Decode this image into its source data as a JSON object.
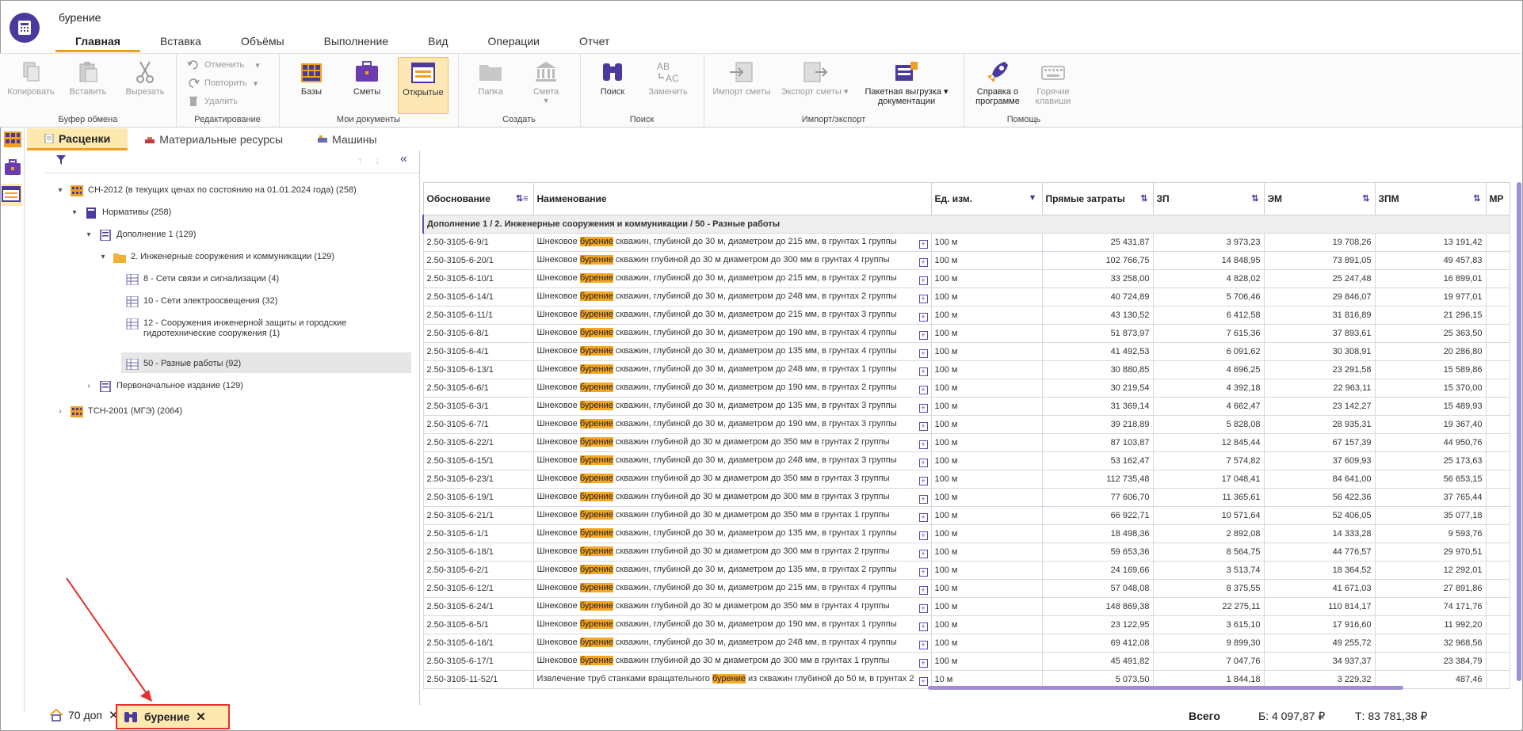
{
  "app": {
    "title": "бурение"
  },
  "ribbon_tabs": [
    "Главная",
    "Вставка",
    "Объёмы",
    "Выполнение",
    "Вид",
    "Операции",
    "Отчет"
  ],
  "ribbon": {
    "clipboard": {
      "group": "Буфер обмена",
      "copy": "Копировать",
      "paste": "Вставить",
      "cut": "Вырезать"
    },
    "editing": {
      "group": "Редактирование",
      "undo": "Отменить",
      "redo": "Повторить",
      "delete": "Удалить"
    },
    "mydocs": {
      "group": "Мои документы",
      "bases": "Базы",
      "estimates": "Сметы",
      "open": "Открытые"
    },
    "create": {
      "group": "Создать",
      "folder": "Папка",
      "estimate": "Смета"
    },
    "search": {
      "group": "Поиск",
      "find": "Поиск",
      "replace": "Заменить"
    },
    "importexport": {
      "group": "Импорт/экспорт",
      "import": "Импорт сметы",
      "export": "Экспорт сметы",
      "batch_line1": "Пакетная выгрузка",
      "batch_line2": "документации"
    },
    "help": {
      "group": "Помощь",
      "about_line1": "Справка о",
      "about_line2": "программе",
      "hotkeys_line1": "Горячие",
      "hotkeys_line2": "клавиши"
    }
  },
  "subtabs": [
    "Расценки",
    "Материальные ресурсы",
    "Машины"
  ],
  "tree": {
    "n1": "СН-2012 (в текущих ценах по состоянию на 01.01.2024 года) (258)",
    "n2": "Нормативы (258)",
    "n3": "Дополнение 1 (129)",
    "n4": "2. Инженерные сооружения и коммуникации (129)",
    "n5": "8 - Сети связи и сигнализации (4)",
    "n6": "10 - Сети электроосвещения (32)",
    "n7a": "12 - Сооружения инженерной защиты и городские",
    "n7b": "гидротехнические сооружения (1)",
    "n8": "50 - Разные работы (92)",
    "n9": "Первоначальное издание (129)",
    "n10": "ТСН-2001 (МГЭ) (2064)"
  },
  "table": {
    "headers": {
      "code": "Обоснование",
      "name": "Наименование",
      "unit": "Ед. изм.",
      "direct": "Прямые затраты",
      "zp": "ЗП",
      "em": "ЭМ",
      "zpm": "ЗПМ",
      "extra": "МР"
    },
    "group": "Дополнение 1 / 2. Инженерные сооружения и коммуникации / 50 - Разные работы",
    "highlight": "бурение",
    "rows": [
      {
        "code": "2.50-3105-6-9/1",
        "pre": "Шнековое ",
        "post": " скважин, глубиной до 30 м, диаметром до 215 мм, в грунтах 1 группы",
        "unit": "100 м",
        "direct": "25 431,87",
        "zp": "3 973,23",
        "em": "19 708,26",
        "zpm": "13 191,42"
      },
      {
        "code": "2.50-3105-6-20/1",
        "pre": "Шнековое ",
        "post": " скважин глубиной до 30 м диаметром до 300 мм в грунтах 4 группы",
        "unit": "100 м",
        "direct": "102 766,75",
        "zp": "14 848,95",
        "em": "73 891,05",
        "zpm": "49 457,83"
      },
      {
        "code": "2.50-3105-6-10/1",
        "pre": "Шнековое ",
        "post": " скважин, глубиной до 30 м, диаметром до 215 мм, в грунтах 2 группы",
        "unit": "100 м",
        "direct": "33 258,00",
        "zp": "4 828,02",
        "em": "25 247,48",
        "zpm": "16 899,01"
      },
      {
        "code": "2.50-3105-6-14/1",
        "pre": "Шнековое ",
        "post": " скважин, глубиной до 30 м, диаметром до 248 мм, в грунтах 2 группы",
        "unit": "100 м",
        "direct": "40 724,89",
        "zp": "5 706,46",
        "em": "29 846,07",
        "zpm": "19 977,01"
      },
      {
        "code": "2.50-3105-6-11/1",
        "pre": "Шнековое ",
        "post": " скважин, глубиной до 30 м, диаметром до 215 мм, в грунтах 3 группы",
        "unit": "100 м",
        "direct": "43 130,52",
        "zp": "6 412,58",
        "em": "31 816,89",
        "zpm": "21 296,15"
      },
      {
        "code": "2.50-3105-6-8/1",
        "pre": "Шнековое ",
        "post": " скважин, глубиной до 30 м, диаметром до 190 мм, в грунтах 4 группы",
        "unit": "100 м",
        "direct": "51 873,97",
        "zp": "7 615,36",
        "em": "37 893,61",
        "zpm": "25 363,50"
      },
      {
        "code": "2.50-3105-6-4/1",
        "pre": "Шнековое ",
        "post": " скважин, глубиной до 30 м, диаметром до 135 мм, в грунтах 4 группы",
        "unit": "100 м",
        "direct": "41 492,53",
        "zp": "6 091,62",
        "em": "30 308,91",
        "zpm": "20 286,80"
      },
      {
        "code": "2.50-3105-6-13/1",
        "pre": "Шнековое ",
        "post": " скважин, глубиной до 30 м, диаметром до 248 мм, в грунтах 1 группы",
        "unit": "100 м",
        "direct": "30 880,85",
        "zp": "4 696,25",
        "em": "23 291,58",
        "zpm": "15 589,86"
      },
      {
        "code": "2.50-3105-6-6/1",
        "pre": "Шнековое ",
        "post": " скважин, глубиной до 30 м, диаметром до 190 мм, в грунтах 2 группы",
        "unit": "100 м",
        "direct": "30 219,54",
        "zp": "4 392,18",
        "em": "22 963,11",
        "zpm": "15 370,00"
      },
      {
        "code": "2.50-3105-6-3/1",
        "pre": "Шнековое ",
        "post": " скважин, глубиной до 30 м, диаметром до 135 мм, в грунтах 3 группы",
        "unit": "100 м",
        "direct": "31 369,14",
        "zp": "4 662,47",
        "em": "23 142,27",
        "zpm": "15 489,93"
      },
      {
        "code": "2.50-3105-6-7/1",
        "pre": "Шнековое ",
        "post": " скважин, глубиной до 30 м, диаметром до 190 мм, в грунтах 3 группы",
        "unit": "100 м",
        "direct": "39 218,89",
        "zp": "5 828,08",
        "em": "28 935,31",
        "zpm": "19 367,40"
      },
      {
        "code": "2.50-3105-6-22/1",
        "pre": "Шнековое ",
        "post": " скважин глубиной до 30 м диаметром до 350 мм в грунтах 2 группы",
        "unit": "100 м",
        "direct": "87 103,87",
        "zp": "12 845,44",
        "em": "67 157,39",
        "zpm": "44 950,76"
      },
      {
        "code": "2.50-3105-6-15/1",
        "pre": "Шнековое ",
        "post": " скважин, глубиной до 30 м, диаметром до 248 мм, в грунтах 3 группы",
        "unit": "100 м",
        "direct": "53 162,47",
        "zp": "7 574,82",
        "em": "37 609,93",
        "zpm": "25 173,63"
      },
      {
        "code": "2.50-3105-6-23/1",
        "pre": "Шнековое ",
        "post": " скважин глубиной до 30 м диаметром до 350 мм в грунтах 3 группы",
        "unit": "100 м",
        "direct": "112 735,48",
        "zp": "17 048,41",
        "em": "84 641,00",
        "zpm": "56 653,15"
      },
      {
        "code": "2.50-3105-6-19/1",
        "pre": "Шнековое ",
        "post": " скважин глубиной до 30 м диаметром до 300 мм в грунтах 3 группы",
        "unit": "100 м",
        "direct": "77 606,70",
        "zp": "11 365,61",
        "em": "56 422,36",
        "zpm": "37 765,44"
      },
      {
        "code": "2.50-3105-6-21/1",
        "pre": "Шнековое ",
        "post": " скважин глубиной до 30 м диаметром до 350 мм в грунтах 1 группы",
        "unit": "100 м",
        "direct": "66 922,71",
        "zp": "10 571,64",
        "em": "52 406,05",
        "zpm": "35 077,18"
      },
      {
        "code": "2.50-3105-6-1/1",
        "pre": "Шнековое ",
        "post": " скважин, глубиной до 30 м, диаметром до 135 мм, в грунтах 1 группы",
        "unit": "100 м",
        "direct": "18 498,36",
        "zp": "2 892,08",
        "em": "14 333,28",
        "zpm": "9 593,76"
      },
      {
        "code": "2.50-3105-6-18/1",
        "pre": "Шнековое ",
        "post": " скважин глубиной до 30 м диаметром до 300 мм в грунтах 2 группы",
        "unit": "100 м",
        "direct": "59 653,36",
        "zp": "8 564,75",
        "em": "44 776,57",
        "zpm": "29 970,51"
      },
      {
        "code": "2.50-3105-6-2/1",
        "pre": "Шнековое ",
        "post": " скважин, глубиной до 30 м, диаметром до 135 мм, в грунтах 2 группы",
        "unit": "100 м",
        "direct": "24 169,66",
        "zp": "3 513,74",
        "em": "18 364,52",
        "zpm": "12 292,01"
      },
      {
        "code": "2.50-3105-6-12/1",
        "pre": "Шнековое ",
        "post": " скважин, глубиной до 30 м, диаметром до 215 мм, в грунтах 4 группы",
        "unit": "100 м",
        "direct": "57 048,08",
        "zp": "8 375,55",
        "em": "41 671,03",
        "zpm": "27 891,86"
      },
      {
        "code": "2.50-3105-6-24/1",
        "pre": "Шнековое ",
        "post": " скважин глубиной до 30 м диаметром до 350 мм в грунтах 4 группы",
        "unit": "100 м",
        "direct": "148 869,38",
        "zp": "22 275,11",
        "em": "110 814,17",
        "zpm": "74 171,76"
      },
      {
        "code": "2.50-3105-6-5/1",
        "pre": "Шнековое ",
        "post": " скважин, глубиной до 30 м, диаметром до 190 мм, в грунтах 1 группы",
        "unit": "100 м",
        "direct": "23 122,95",
        "zp": "3 615,10",
        "em": "17 916,60",
        "zpm": "11 992,20"
      },
      {
        "code": "2.50-3105-6-16/1",
        "pre": "Шнековое ",
        "post": " скважин, глубиной до 30 м, диаметром до 248 мм, в грунтах 4 группы",
        "unit": "100 м",
        "direct": "69 412,08",
        "zp": "9 899,30",
        "em": "49 255,72",
        "zpm": "32 968,56"
      },
      {
        "code": "2.50-3105-6-17/1",
        "pre": "Шнековое ",
        "post": " скважин глубиной до 30 м диаметром до 300 мм в грунтах 1 группы",
        "unit": "100 м",
        "direct": "45 491,82",
        "zp": "7 047,76",
        "em": "34 937,37",
        "zpm": "23 384,79"
      },
      {
        "code": "2.50-3105-11-52/1",
        "pre": "Извлечение труб станками вращательного ",
        "post": " из скважин глубиной до 50 м, в грунтах 2",
        "unit": "10 м",
        "direct": "5 073,50",
        "zp": "1 844,18",
        "em": "3 229,32",
        "zpm": "487,46"
      }
    ]
  },
  "bottom": {
    "tab1": "70 доп",
    "tab2": "бурение",
    "total_label": "Всего",
    "b_value": "Б: 4 097,87 ₽",
    "t_value": "Т: 83 781,38 ₽"
  }
}
